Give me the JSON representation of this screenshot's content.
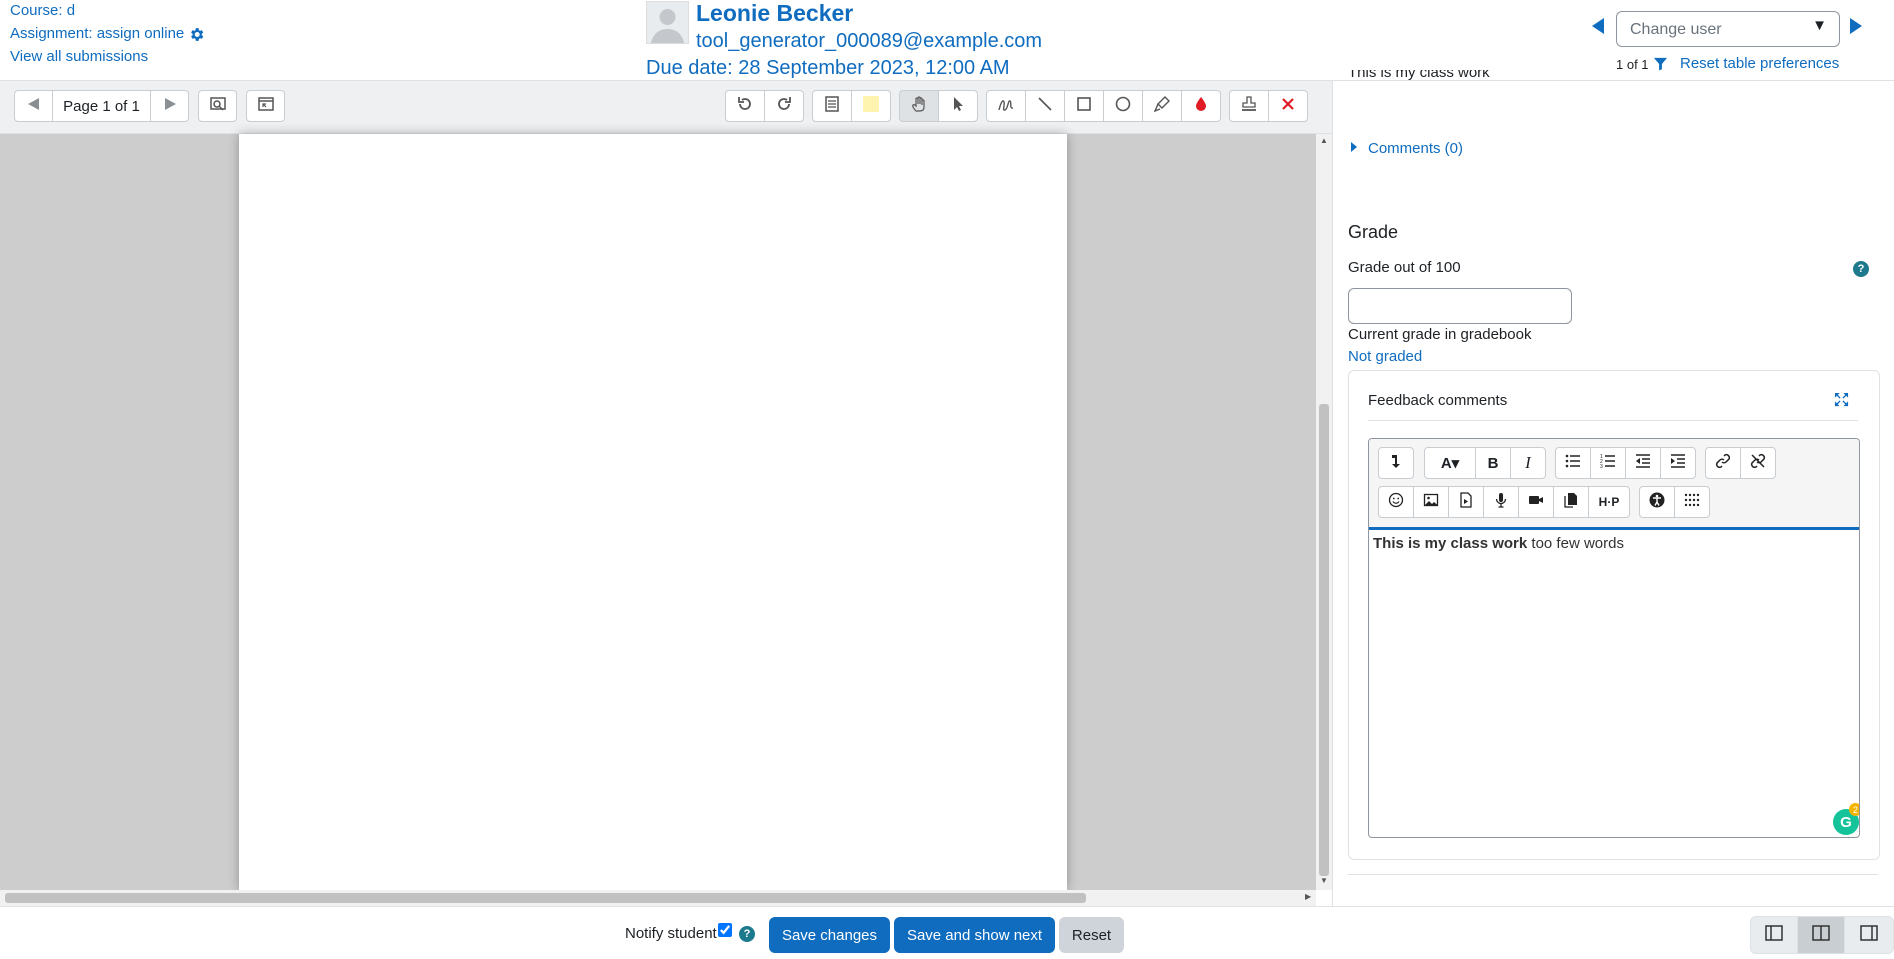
{
  "header": {
    "course_label": "Course: d",
    "assignment_label": "Assignment: assign online",
    "view_all": "View all submissions",
    "user_name": "Leonie Becker",
    "user_email": "tool_generator_000089@example.com",
    "due_date": "Due date: 28 September 2023, 12:00 AM",
    "change_user_placeholder": "Change user",
    "pager": "1 of 1",
    "reset_prefs": "Reset table preferences"
  },
  "pdf_toolbar": {
    "page_label": "Page 1 of 1",
    "icons": [
      "prev-page-icon",
      "next-page-icon",
      "search-comments-icon",
      "expand-icon",
      "rotate-left-icon",
      "rotate-right-icon",
      "comment-icon",
      "comment-color-icon",
      "pan-icon",
      "select-icon",
      "pen-icon",
      "line-icon",
      "rectangle-icon",
      "oval-icon",
      "highlight-icon",
      "annotation-color-icon",
      "stamp-icon",
      "delete-icon"
    ]
  },
  "panel": {
    "submission_text": "This is my class work",
    "comments_label": "Comments (0)",
    "grade_heading": "Grade",
    "grade_out_of": "Grade out of 100",
    "grade_value": "",
    "current_grade_label": "Current grade in gradebook",
    "current_grade_value": "Not graded",
    "feedback_label": "Feedback comments",
    "editor_bold_text": "This is my class work",
    "editor_rest_text": " too few words",
    "grammarly_count": "2"
  },
  "footer": {
    "notify_label": "Notify student",
    "notify_checked": true,
    "save_changes": "Save changes",
    "save_next": "Save and show next",
    "reset": "Reset"
  },
  "colors": {
    "link": "#0f6cbf",
    "primary_button": "#0f6cbf",
    "secondary_button": "#ced4da",
    "help_icon": "#1d7a8c",
    "annotation_red": "#e01b24",
    "comment_yellow": "#fff3b0"
  }
}
